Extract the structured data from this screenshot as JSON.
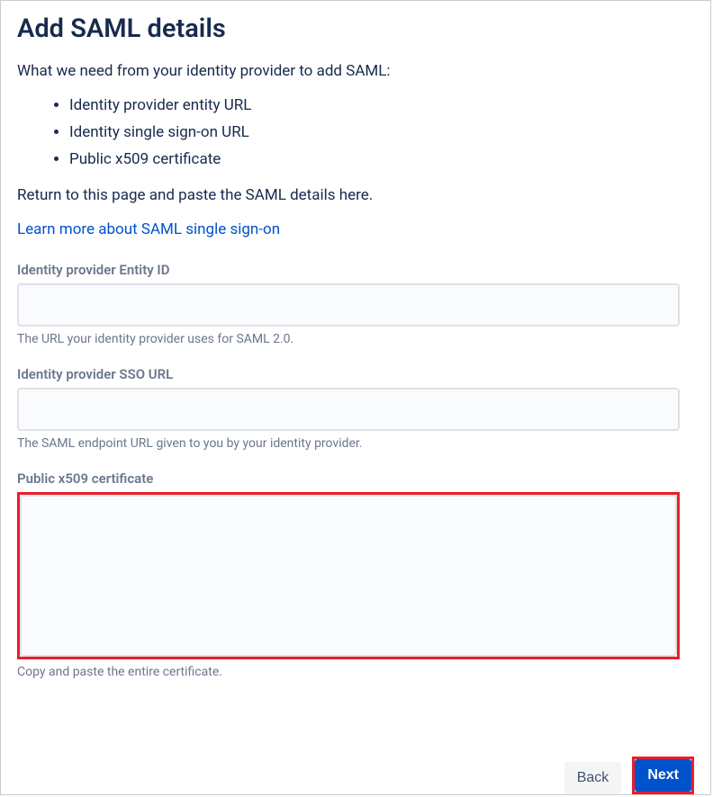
{
  "heading": "Add SAML details",
  "intro": "What we need from your identity provider to add SAML:",
  "requirements": [
    "Identity provider entity URL",
    "Identity single sign-on URL",
    "Public x509 certificate"
  ],
  "returnText": "Return to this page and paste the SAML details here.",
  "learnMoreLink": "Learn more about SAML single sign-on",
  "fields": {
    "entityId": {
      "label": "Identity provider Entity ID",
      "value": "",
      "help": "The URL your identity provider uses for SAML 2.0."
    },
    "ssoUrl": {
      "label": "Identity provider SSO URL",
      "value": "",
      "help": "The SAML endpoint URL given to you by your identity provider."
    },
    "certificate": {
      "label": "Public x509 certificate",
      "value": "",
      "help": "Copy and paste the entire certificate."
    }
  },
  "buttons": {
    "back": "Back",
    "next": "Next"
  }
}
